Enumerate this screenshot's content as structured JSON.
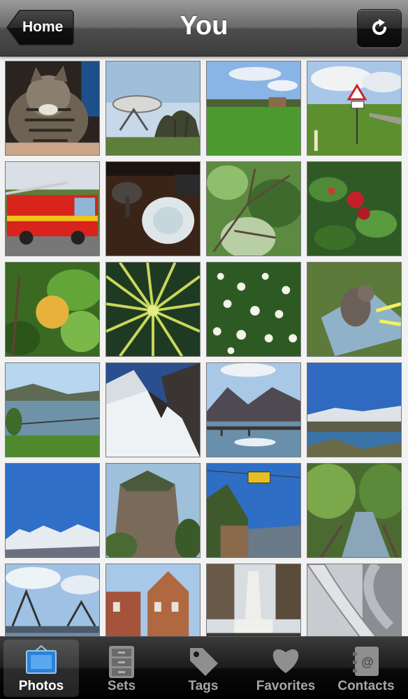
{
  "navbar": {
    "title": "You",
    "home_label": "Home"
  },
  "tabs": [
    {
      "label": "Photos",
      "icon": "photo-frame-icon",
      "active": true
    },
    {
      "label": "Sets",
      "icon": "drawer-cabinet-icon",
      "active": false
    },
    {
      "label": "Tags",
      "icon": "tag-icon",
      "active": false
    },
    {
      "label": "Favorites",
      "icon": "heart-icon",
      "active": false
    },
    {
      "label": "Contacts",
      "icon": "address-book-icon",
      "active": false
    }
  ],
  "photos": [
    "tabby cat",
    "radio telescope",
    "green park",
    "road sign field",
    "red fire engine",
    "cat and dish",
    "twigs in leaves",
    "red berries",
    "orange fruit",
    "spiky yucca",
    "daisies",
    "cat on stone",
    "coastal bay",
    "snowy slope",
    "lake pier",
    "mountain lake",
    "snowy peaks",
    "rock cliff",
    "cable car valley",
    "forest stream",
    "harbour bridge",
    "brick building",
    "monument",
    "playground slide"
  ]
}
